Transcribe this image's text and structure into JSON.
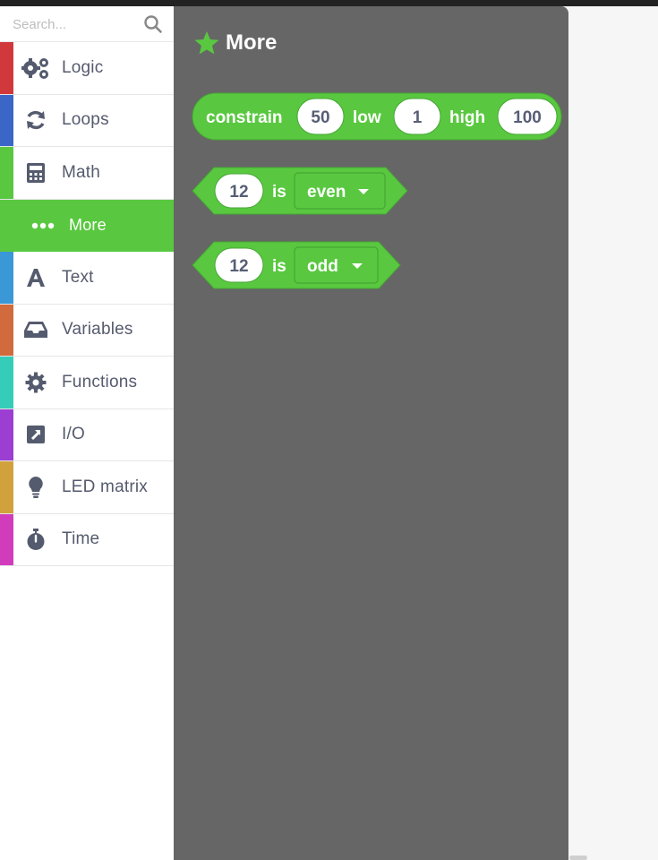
{
  "search": {
    "placeholder": "Search..."
  },
  "sidebar": {
    "items": [
      {
        "label": "Logic",
        "icon": "gears-icon",
        "color": "#d1383c"
      },
      {
        "label": "Loops",
        "icon": "refresh-icon",
        "color": "#3a66c8"
      },
      {
        "label": "Math",
        "icon": "calculator-icon",
        "color": "#59c840"
      },
      {
        "label": "More",
        "icon": "ellipsis-icon",
        "color": "#59c840",
        "selected": true
      },
      {
        "label": "Text",
        "icon": "text-icon",
        "color": "#3a98d6"
      },
      {
        "label": "Variables",
        "icon": "inbox-icon",
        "color": "#d16a3c"
      },
      {
        "label": "Functions",
        "icon": "cog-icon",
        "color": "#35cdb9"
      },
      {
        "label": "I/O",
        "icon": "external-arrow-icon",
        "color": "#9b3ed1"
      },
      {
        "label": "LED matrix",
        "icon": "lightbulb-icon",
        "color": "#d1a23c"
      },
      {
        "label": "Time",
        "icon": "stopwatch-icon",
        "color": "#d13cbc"
      }
    ]
  },
  "flyout": {
    "title": "More",
    "title_icon": "star-icon",
    "block_color": "#59c840",
    "blocks": [
      {
        "type": "constrain",
        "label": "constrain",
        "value": "50",
        "low_label": "low",
        "low": "1",
        "high_label": "high",
        "high": "100"
      },
      {
        "type": "parity",
        "value": "12",
        "is_label": "is",
        "option": "even"
      },
      {
        "type": "parity",
        "value": "12",
        "is_label": "is",
        "option": "odd"
      }
    ]
  }
}
